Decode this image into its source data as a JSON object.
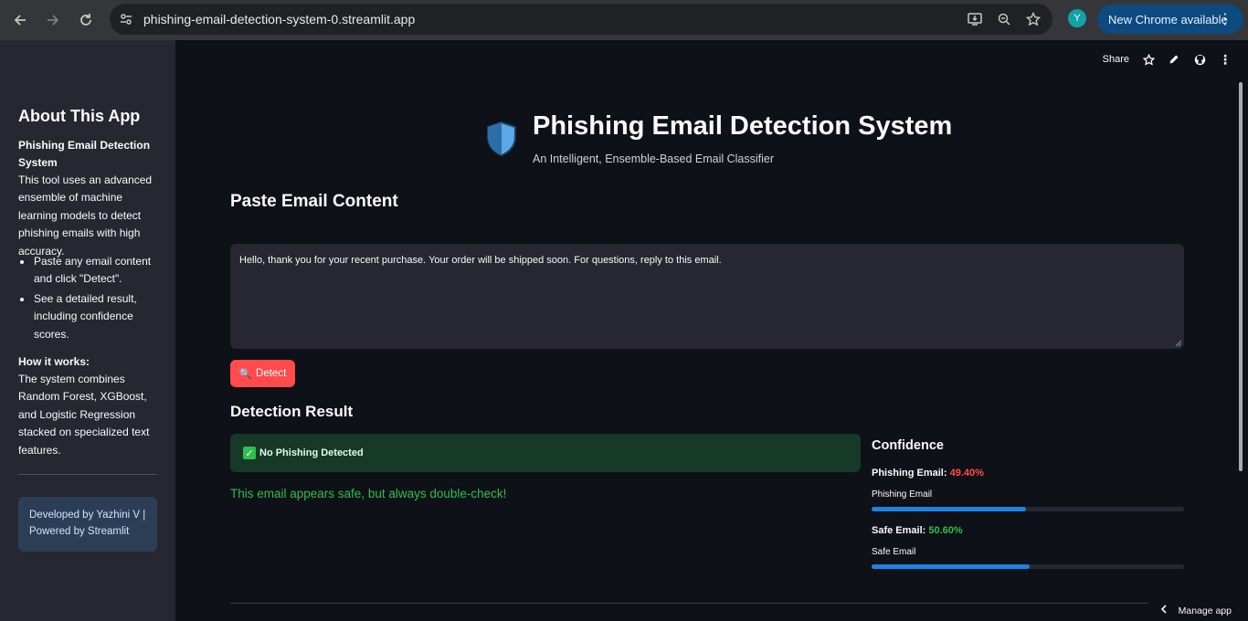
{
  "browser": {
    "url": "phishing-email-detection-system-0.streamlit.app",
    "profile_initial": "Y",
    "update_label": "New Chrome available"
  },
  "sidebar": {
    "title": "About This App",
    "intro_bold": "Phishing Email Detection System",
    "intro_text": "This tool uses an advanced ensemble of machine learning models to detect phishing emails with high accuracy.",
    "bullets": [
      "Paste any email content and click \"Detect\".",
      "See a detailed result, including confidence scores."
    ],
    "how_title": "How it works:",
    "how_text": "The system combines Random Forest, XGBoost, and Logistic Regression stacked on specialized text features.",
    "credit": "Developed by Yazhini V | Powered by Streamlit"
  },
  "toolbar": {
    "share_label": "Share"
  },
  "header": {
    "title": "Phishing Email Detection System",
    "subtitle": "An Intelligent, Ensemble-Based Email Classifier"
  },
  "input": {
    "section_title": "Paste Email Content",
    "value": "Hello, thank you for your recent purchase. Your order will be shipped soon. For questions, reply to this email.",
    "button_label": "Detect"
  },
  "result": {
    "section_title": "Detection Result",
    "status": "No Phishing Detected",
    "message": "This email appears safe, but always double-check!"
  },
  "confidence": {
    "title": "Confidence",
    "phishing_label": "Phishing Email:",
    "phishing_value": "49.40%",
    "phishing_bar_label": "Phishing Email",
    "phishing_fraction": 0.494,
    "safe_label": "Safe Email:",
    "safe_value": "50.60%",
    "safe_bar_label": "Safe Email",
    "safe_fraction": 0.506
  },
  "footer": {
    "manage_label": "Manage app"
  },
  "colors": {
    "accent": "#ff4b4b",
    "safe": "#2fbf4f",
    "bar": "#1c83e1"
  }
}
